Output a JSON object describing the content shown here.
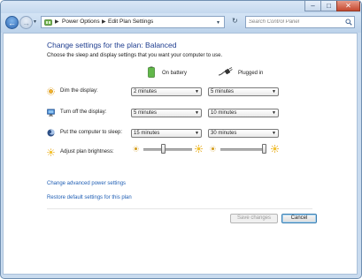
{
  "window": {
    "minimize_label": "–",
    "maximize_label": "□",
    "close_label": "✕"
  },
  "nav": {
    "back_glyph": "←",
    "forward_glyph": "→",
    "dropdown_glyph": "▾",
    "breadcrumb": [
      "Power Options",
      "Edit Plan Settings"
    ],
    "separator": "▶",
    "address_dropdown": "▾",
    "refresh_glyph": "↻",
    "search_placeholder": "Search Control Panel",
    "search_icon": "search-icon"
  },
  "header": {
    "title": "Change settings for the plan: Balanced",
    "subtitle": "Choose the sleep and display settings that you want your computer to use."
  },
  "columns": {
    "battery": "On battery",
    "plugged": "Plugged in"
  },
  "rows": [
    {
      "label": "Dim the display:",
      "battery": "2 minutes",
      "plugged": "5 minutes",
      "icon": "dim-display-icon"
    },
    {
      "label": "Turn off the display:",
      "battery": "5 minutes",
      "plugged": "10 minutes",
      "icon": "display-icon"
    },
    {
      "label": "Put the computer to sleep:",
      "battery": "15 minutes",
      "plugged": "30 minutes",
      "icon": "sleep-icon"
    }
  ],
  "brightness": {
    "label": "Adjust plan brightness:",
    "battery_level": 0.4,
    "plugged_level": 1.0
  },
  "links": {
    "advanced": "Change advanced power settings",
    "restore": "Restore default settings for this plan"
  },
  "buttons": {
    "save": "Save changes",
    "cancel": "Cancel"
  },
  "colors": {
    "title_blue": "#1e3d8f",
    "link_blue": "#1f5eb4",
    "frame": "#c9dbef"
  }
}
